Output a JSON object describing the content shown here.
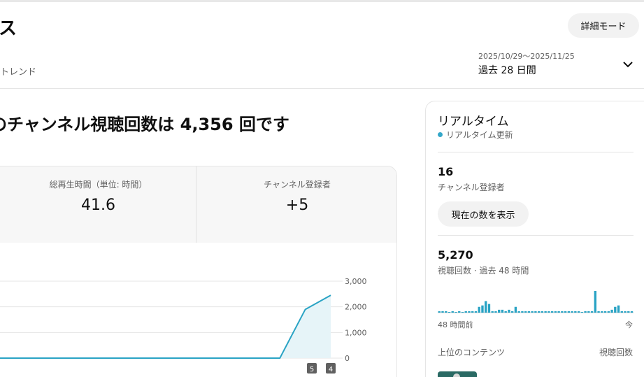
{
  "header": {
    "title": "ス",
    "detail_button": "詳細モード",
    "subtab": "トレンド",
    "date_range": "2025/10/29〜2025/11/25",
    "period": "過去 28 日間"
  },
  "summary": {
    "headline": "のチャンネル視聴回数は 4,356 回です",
    "metrics": [
      {
        "label": "総再生時間（単位: 時間）",
        "value": "41.6"
      },
      {
        "label": "チャンネル登録者",
        "value": "+5"
      }
    ]
  },
  "chart_data": {
    "type": "area",
    "y_ticks": [
      "3,000",
      "2,000",
      "1,000",
      "0"
    ],
    "ylim": [
      0,
      3000
    ],
    "x": [
      0,
      1,
      2,
      3,
      4,
      5,
      6,
      7,
      8,
      9,
      10,
      11,
      12,
      13
    ],
    "values": [
      0,
      0,
      0,
      0,
      0,
      0,
      0,
      0,
      0,
      0,
      0,
      0,
      1900,
      2450
    ],
    "markers": [
      "5",
      "4"
    ],
    "color": "#29a3c4"
  },
  "realtime": {
    "title": "リアルタイム",
    "live_label": "リアルタイム更新",
    "subscribers": "16",
    "subscribers_label": "チャンネル登録者",
    "show_button": "現在の数を表示",
    "views": "5,270",
    "views_label": "視聴回数 · 過去 48 時間",
    "axis_start": "48 時間前",
    "axis_end": "今",
    "top_content_label": "上位のコンテンツ",
    "top_content_metric": "視聴回数",
    "bars": [
      1,
      1,
      1,
      0,
      1,
      0,
      1,
      0,
      1,
      1,
      1,
      1,
      4,
      5,
      8,
      6,
      1,
      1,
      2,
      2,
      1,
      2,
      1,
      4,
      1,
      1,
      1,
      1,
      1,
      1,
      1,
      1,
      1,
      1,
      1,
      1,
      1,
      1,
      1,
      1,
      1,
      1,
      1,
      0,
      1,
      1,
      1,
      15,
      1,
      1,
      1,
      1,
      2,
      4,
      5,
      1,
      1,
      1,
      1
    ],
    "bar_color": "#29a3c4"
  }
}
